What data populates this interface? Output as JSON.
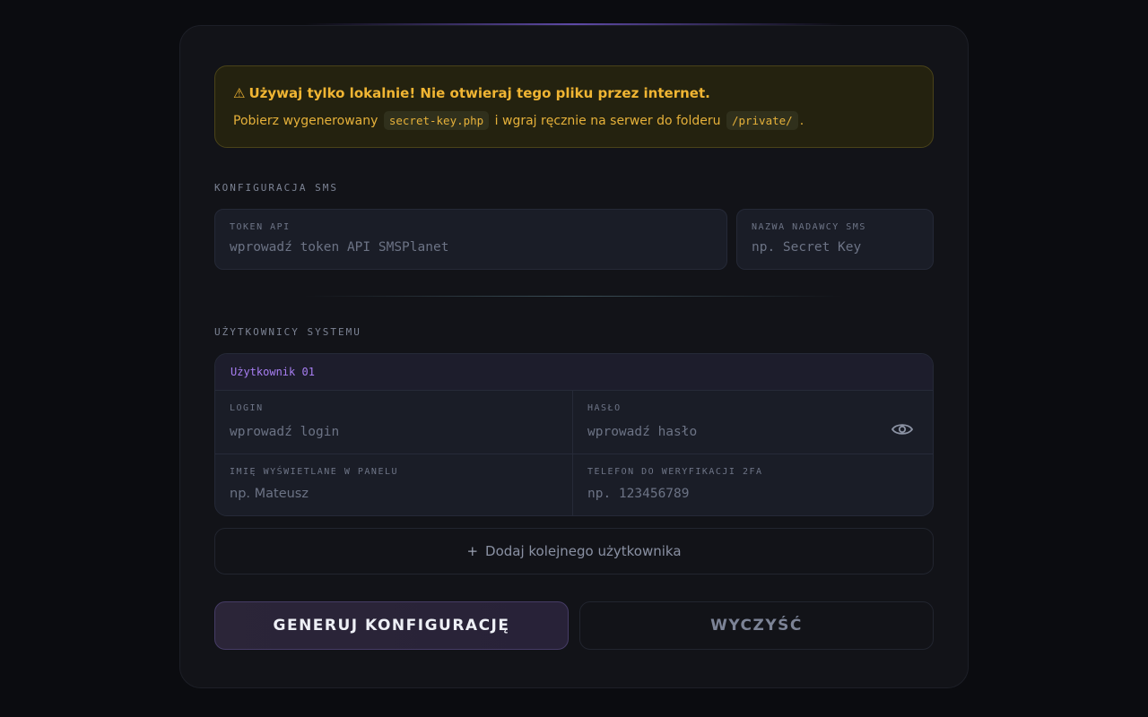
{
  "warning": {
    "icon": "warning-triangle-icon",
    "title": "Używaj tylko lokalnie! Nie otwieraj tego pliku przez internet.",
    "text_before": "Pobierz wygenerowany",
    "file_name": "secret-key.php",
    "text_middle": "i wgraj ręcznie na serwer do folderu",
    "folder": "/private/",
    "text_after": "."
  },
  "sms": {
    "section_label": "KONFIGURACJA SMS",
    "token": {
      "label": "TOKEN API",
      "value": "",
      "placeholder": "wprowadź token API SMSPlanet"
    },
    "sender": {
      "label": "NAZWA NADAWCY SMS",
      "value": "",
      "placeholder": "np. Secret Key"
    }
  },
  "users": {
    "section_label": "UŻYTKOWNICY SYSTEMU",
    "items": [
      {
        "header": "Użytkownik 01",
        "login": {
          "label": "LOGIN",
          "value": "",
          "placeholder": "wprowadź login"
        },
        "password": {
          "label": "HASŁO",
          "value": "",
          "placeholder": "wprowadź hasło",
          "toggle_icon": "eye-icon"
        },
        "display_name": {
          "label": "IMIĘ WYŚWIETLANE W PANELU",
          "value": "",
          "placeholder": "np. Mateusz"
        },
        "phone": {
          "label": "TELEFON DO WERYFIKACJI 2FA",
          "value": "",
          "placeholder": "np. 123456789"
        }
      }
    ],
    "add_button": {
      "icon": "plus-icon",
      "label": "Dodaj kolejnego użytkownika"
    }
  },
  "actions": {
    "generate_label": "GENERUJ KONFIGURACJĘ",
    "clear_label": "WYCZYŚĆ"
  },
  "colors": {
    "accent_purple": "#a77ef2",
    "warning_yellow": "#f0b533",
    "background": "#0b0c10",
    "card": "#121318"
  }
}
